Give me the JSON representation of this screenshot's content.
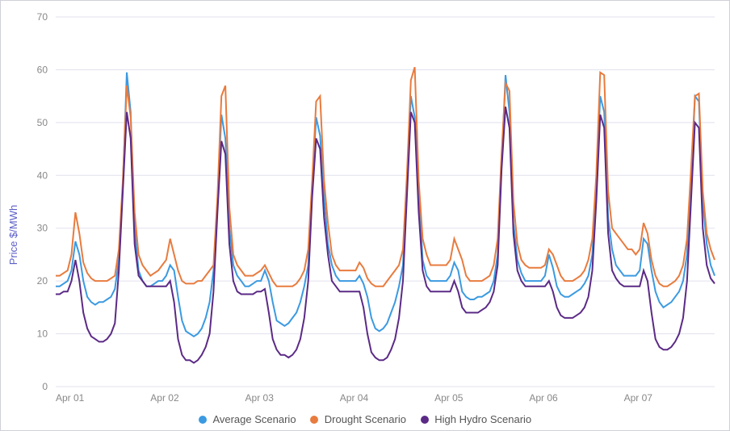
{
  "chart_data": {
    "type": "line",
    "title": "",
    "xlabel": "",
    "ylabel": "Price $/MWh",
    "ylim": [
      0,
      70
    ],
    "yticks": [
      0,
      10,
      20,
      30,
      40,
      50,
      60,
      70
    ],
    "xticks": [
      "Apr 01",
      "Apr 02",
      "Apr 03",
      "Apr 04",
      "Apr 05",
      "Apr 06",
      "Apr 07"
    ],
    "legend_position": "bottom",
    "series": [
      {
        "name": "Average Scenario",
        "color": "#3b9ae1",
        "values": [
          19,
          19,
          19.5,
          20,
          22,
          27.5,
          25,
          20,
          17,
          16,
          15.5,
          16,
          16,
          16.5,
          17,
          18.5,
          24,
          38,
          59.5,
          52,
          30,
          22,
          20,
          19,
          19,
          19.5,
          20,
          20,
          21,
          23,
          22,
          17,
          12.5,
          10.5,
          10,
          9.5,
          10,
          11,
          13,
          16,
          22,
          35,
          51.5,
          47,
          30,
          23,
          21,
          20,
          19,
          19,
          19.5,
          20,
          20,
          22,
          20,
          16,
          12.5,
          12,
          11.5,
          12,
          13,
          14,
          16,
          19,
          23,
          38,
          51,
          47.5,
          36,
          27,
          23,
          21,
          20,
          20,
          20,
          20,
          20,
          21,
          19.5,
          17,
          13,
          11,
          10.5,
          11,
          12,
          14,
          16,
          19,
          23,
          38,
          55,
          51,
          37,
          24,
          21,
          20,
          20,
          20,
          20,
          20,
          21,
          23.5,
          22,
          18,
          17,
          16.5,
          16.5,
          17,
          17,
          17.5,
          18,
          20,
          25,
          42,
          59,
          52,
          31,
          24,
          21.5,
          20,
          20,
          20,
          20,
          20,
          21,
          25,
          22.5,
          19,
          17.5,
          17,
          17,
          17.5,
          18,
          18.5,
          19.5,
          21,
          25,
          38,
          55,
          52,
          32,
          26,
          23,
          22,
          21,
          21,
          21,
          21,
          22,
          28,
          27,
          22,
          18,
          16,
          15,
          15.5,
          16,
          17,
          18,
          20,
          25,
          38,
          55,
          54,
          35,
          27,
          23,
          21
        ]
      },
      {
        "name": "Drought Scenario",
        "color": "#e87b3e",
        "values": [
          21,
          21,
          21.5,
          22,
          25,
          33,
          29,
          23.5,
          21.5,
          20.5,
          20,
          20,
          20,
          20,
          20.5,
          21,
          26,
          39,
          57,
          51,
          33,
          25,
          23,
          22,
          21,
          21.5,
          22,
          23,
          24,
          28,
          25,
          22,
          20,
          19.5,
          19.5,
          19.5,
          20,
          20,
          21,
          22,
          23,
          36,
          55,
          57,
          34,
          25,
          23,
          22,
          21,
          21,
          21,
          21.5,
          22,
          23,
          21.5,
          20,
          19,
          19,
          19,
          19,
          19,
          19.5,
          20.5,
          22,
          26,
          39,
          54,
          55,
          39,
          31,
          25,
          23,
          22,
          22,
          22,
          22,
          22,
          23.5,
          22.5,
          20.5,
          19.5,
          19,
          19,
          19,
          20,
          21,
          22,
          23,
          26,
          40,
          58,
          60.5,
          39,
          28,
          25,
          23,
          23,
          23,
          23,
          23,
          24,
          28,
          26,
          24,
          21,
          20,
          20,
          20,
          20,
          20.5,
          21,
          23,
          28,
          44,
          57.5,
          56,
          35,
          27,
          24,
          23,
          22.5,
          22.5,
          22.5,
          22.5,
          23,
          26,
          25,
          23,
          21,
          20,
          20,
          20,
          20.5,
          21,
          22,
          24,
          28,
          40,
          59.5,
          59,
          37,
          30,
          29,
          28,
          27,
          26,
          26,
          25,
          26,
          31,
          29,
          24,
          21,
          19.5,
          19,
          19,
          19.5,
          20,
          21,
          23,
          28,
          41,
          55,
          55.5,
          37,
          29,
          26,
          24
        ]
      },
      {
        "name": "High Hydro Scenario",
        "color": "#5b2a86",
        "values": [
          17.5,
          17.5,
          18,
          18,
          20,
          24,
          20,
          14,
          11,
          9.5,
          9,
          8.5,
          8.5,
          9,
          10,
          12,
          22,
          37,
          52,
          47,
          27,
          21,
          20,
          19,
          19,
          19,
          19,
          19,
          19,
          20,
          16,
          9,
          6,
          5,
          5,
          4.5,
          5,
          6,
          7.5,
          10,
          18,
          33,
          46.5,
          44,
          27,
          20,
          18,
          17.5,
          17.5,
          17.5,
          17.5,
          18,
          18,
          18.5,
          14,
          9,
          7,
          6,
          6,
          5.5,
          6,
          7,
          9,
          13,
          20,
          36,
          47,
          45,
          32,
          25,
          20,
          19,
          18,
          18,
          18,
          18,
          18,
          18,
          15,
          10,
          6.5,
          5.5,
          5,
          5,
          5.5,
          7,
          9,
          13,
          20,
          36,
          52,
          50,
          33,
          22,
          19,
          18,
          18,
          18,
          18,
          18,
          18,
          20,
          18,
          15,
          14,
          14,
          14,
          14,
          14.5,
          15,
          16,
          18,
          23,
          41,
          53,
          49,
          29,
          22,
          20,
          19,
          19,
          19,
          19,
          19,
          19,
          20,
          18,
          15,
          13.5,
          13,
          13,
          13,
          13.5,
          14,
          15,
          17,
          22,
          35,
          51.5,
          49,
          29,
          22,
          20.5,
          19.5,
          19,
          19,
          19,
          19,
          19,
          22,
          20,
          14,
          9,
          7.5,
          7,
          7,
          7.5,
          8.5,
          10,
          13,
          20,
          35,
          50,
          49,
          30,
          23,
          20.5,
          19.5
        ]
      }
    ]
  },
  "legend": {
    "s1": "Average Scenario",
    "s2": "Drought Scenario",
    "s3": "High Hydro Scenario"
  },
  "axis": {
    "ylabel": "Price $/MWh",
    "y0": "0",
    "y10": "10",
    "y20": "20",
    "y30": "30",
    "y40": "40",
    "y50": "50",
    "y60": "60",
    "y70": "70",
    "x0": "Apr 01",
    "x1": "Apr 02",
    "x2": "Apr 03",
    "x3": "Apr 04",
    "x4": "Apr 05",
    "x5": "Apr 06",
    "x6": "Apr 07"
  }
}
